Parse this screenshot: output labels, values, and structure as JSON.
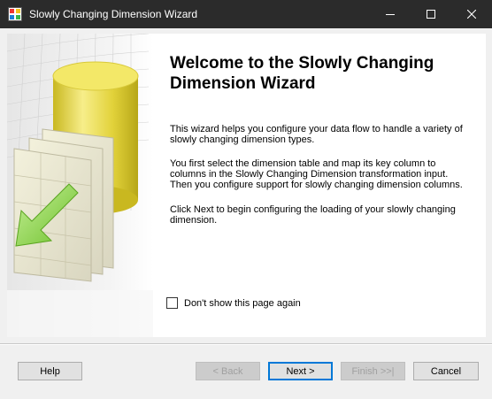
{
  "window": {
    "title": "Slowly Changing Dimension Wizard"
  },
  "page": {
    "heading": "Welcome to the Slowly Changing Dimension Wizard",
    "paragraph1": "This wizard helps you configure your data flow to handle a variety of slowly changing dimension types.",
    "paragraph2": " You first select the dimension table and map its key column to columns in the Slowly Changing Dimension transformation input.\n Then you configure support for slowly changing dimension columns.",
    "paragraph3": " Click  Next to begin configuring the loading of your slowly changing dimension.",
    "checkbox_label": "Don't show this page again",
    "checkbox_checked": false
  },
  "buttons": {
    "help": "Help",
    "back": "< Back",
    "next": "Next >",
    "finish": "Finish >>|",
    "cancel": "Cancel"
  },
  "icons": {
    "app": "wizard-app-icon",
    "minimize": "minimize-icon",
    "maximize": "maximize-icon",
    "close": "close-icon",
    "art": "dimension-cylinder-illustration"
  },
  "colors": {
    "titlebar": "#2b2b2b",
    "client": "#f0f0f0",
    "default_button_border": "#0078d7",
    "cylinder": "#e8d84a",
    "arrow": "#7fcc3a"
  }
}
